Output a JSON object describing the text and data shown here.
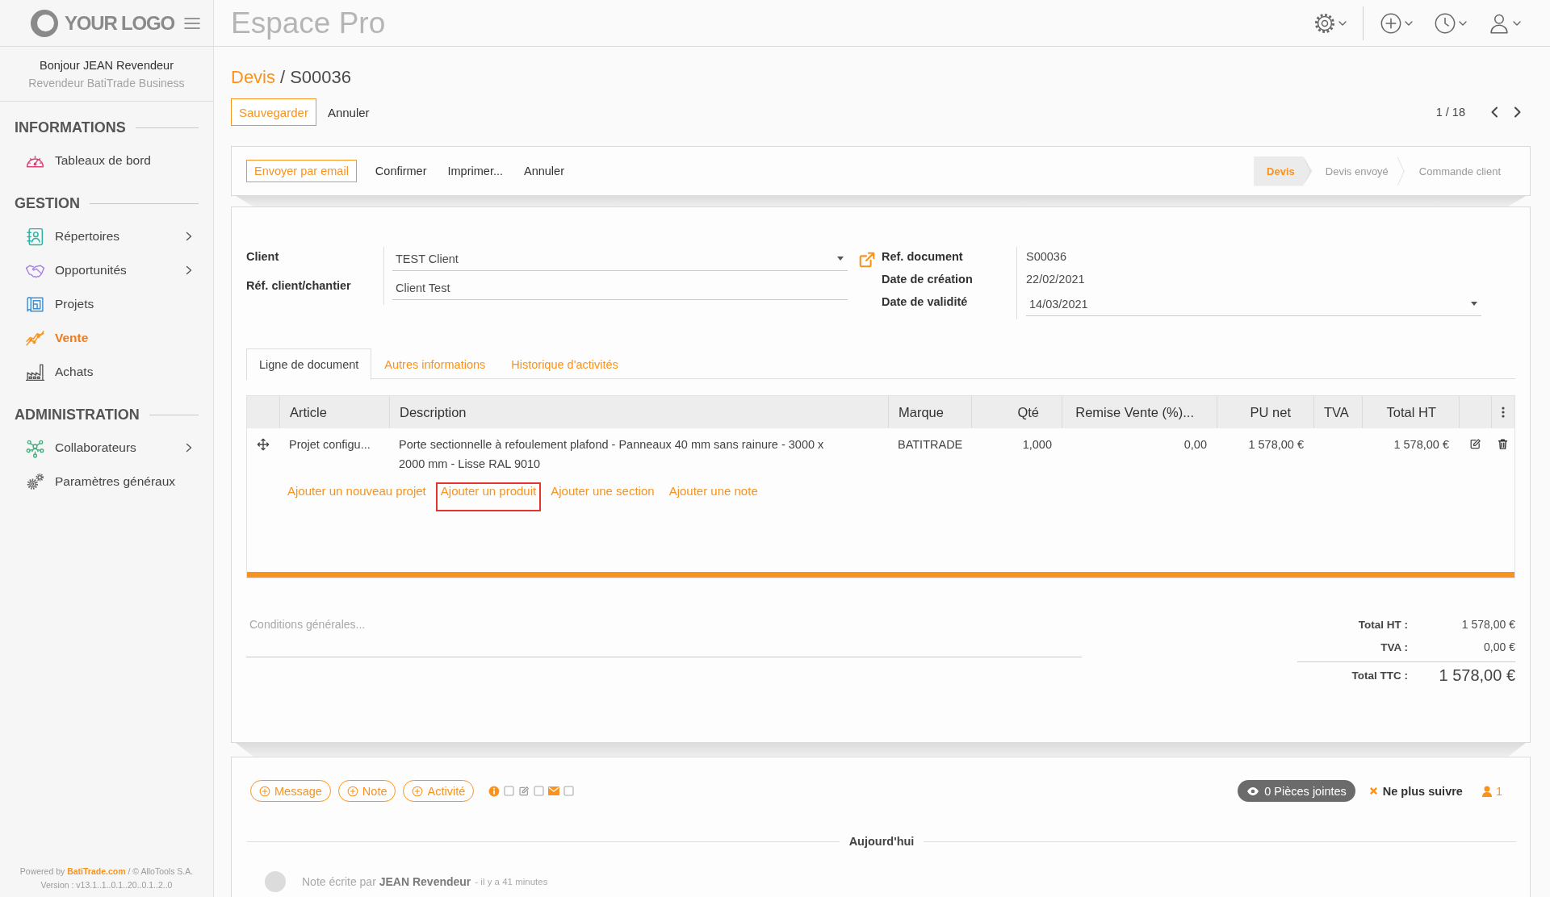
{
  "sidebar": {
    "logo": "YOUR LOGO",
    "greeting": "Bonjour JEAN Revendeur",
    "role": "Revendeur BatiTrade Business",
    "sections": [
      {
        "title": "INFORMATIONS",
        "items": [
          {
            "label": "Tableaux de bord",
            "selected": false,
            "submenu": false
          }
        ]
      },
      {
        "title": "GESTION",
        "items": [
          {
            "label": "Répertoires",
            "selected": false,
            "submenu": true
          },
          {
            "label": "Opportunités",
            "selected": false,
            "submenu": true
          },
          {
            "label": "Projets",
            "selected": false,
            "submenu": false
          },
          {
            "label": "Vente",
            "selected": true,
            "submenu": false
          },
          {
            "label": "Achats",
            "selected": false,
            "submenu": false
          }
        ]
      },
      {
        "title": "ADMINISTRATION",
        "items": [
          {
            "label": "Collaborateurs",
            "selected": false,
            "submenu": true
          },
          {
            "label": "Paramètres généraux",
            "selected": false,
            "submenu": false
          }
        ]
      }
    ],
    "footer": {
      "powered_prefix": "Powered by",
      "powered_link": "BatiTrade.com",
      "powered_suffix": "/ © AlloTools S.A.",
      "version": "Version : v13.1..1..0.1..20..0.1..2..0"
    }
  },
  "topbar": {
    "title": "Espace Pro"
  },
  "breadcrumb": {
    "parent": "Devis",
    "separator": "/",
    "current": "S00036"
  },
  "control_panel": {
    "buttons": [
      {
        "label": "Sauvegarder",
        "kind": "primary"
      },
      {
        "label": "Annuler",
        "kind": "link"
      }
    ],
    "pager": "1 / 18"
  },
  "statusbar": {
    "buttons": [
      {
        "label": "Envoyer par email",
        "kind": "primary"
      },
      {
        "label": "Confirmer",
        "kind": "link"
      },
      {
        "label": "Imprimer...",
        "kind": "link"
      },
      {
        "label": "Annuler",
        "kind": "link"
      }
    ],
    "stages": [
      {
        "label": "Devis",
        "selected": true
      },
      {
        "label": "Devis envoyé",
        "selected": false
      },
      {
        "label": "Commande client",
        "selected": false
      }
    ]
  },
  "form": {
    "left": [
      {
        "label": "Client",
        "value": "TEST Client",
        "kind": "select"
      },
      {
        "label": "Réf. client/chantier",
        "value": "Client Test",
        "kind": "text"
      }
    ],
    "right": [
      {
        "label": "Ref. document",
        "value": "S00036",
        "kind": "readonly"
      },
      {
        "label": "Date de création",
        "value": "22/02/2021",
        "kind": "readonly"
      },
      {
        "label": "Date de validité",
        "value": "14/03/2021",
        "kind": "select"
      }
    ]
  },
  "tabs": [
    {
      "label": "Ligne de document",
      "selected": true
    },
    {
      "label": "Autres informations",
      "selected": false
    },
    {
      "label": "Historique d'activités",
      "selected": false
    }
  ],
  "table": {
    "columns": [
      "Article",
      "Description",
      "Marque",
      "Qté",
      "Remise Vente (%)...",
      "PU net",
      "TVA",
      "Total HT"
    ],
    "rows": [
      {
        "article": "Projet configu...",
        "description": "Porte sectionnelle à refoulement plafond - Panneaux 40 mm sans rainure - 3000 x 2000 mm - Lisse RAL 9010",
        "brand": "BATITRADE",
        "quantity": "1,000",
        "discount": "0,00",
        "unit_price": "1 578,00 €",
        "total": "1 578,00 €"
      }
    ],
    "add_links": [
      {
        "label": "Ajouter un nouveau projet",
        "highlighted": false
      },
      {
        "label": "Ajouter un produit",
        "highlighted": true
      },
      {
        "label": "Ajouter une section",
        "highlighted": false
      },
      {
        "label": "Ajouter une note",
        "highlighted": false
      }
    ]
  },
  "notes": {
    "placeholder": "Conditions générales..."
  },
  "totals": [
    {
      "label": "Total HT :",
      "value": "1 578,00 €",
      "kind": "subtotal"
    },
    {
      "label": "TVA :",
      "value": "0,00 €",
      "kind": "subtotal"
    },
    {
      "label": "Total TTC :",
      "value": "1 578,00 €",
      "kind": "grand"
    }
  ],
  "chatter": {
    "buttons": [
      "Message",
      "Note",
      "Activité"
    ],
    "attachments": "0 Pièces jointes",
    "unfollow": "Ne plus suivre",
    "followers": "1",
    "day_separator": "Aujourd'hui",
    "messages": [
      {
        "author_line": "Note écrite par **JEAN Revendeur**",
        "time": "- il y a 41 minutes"
      }
    ]
  }
}
